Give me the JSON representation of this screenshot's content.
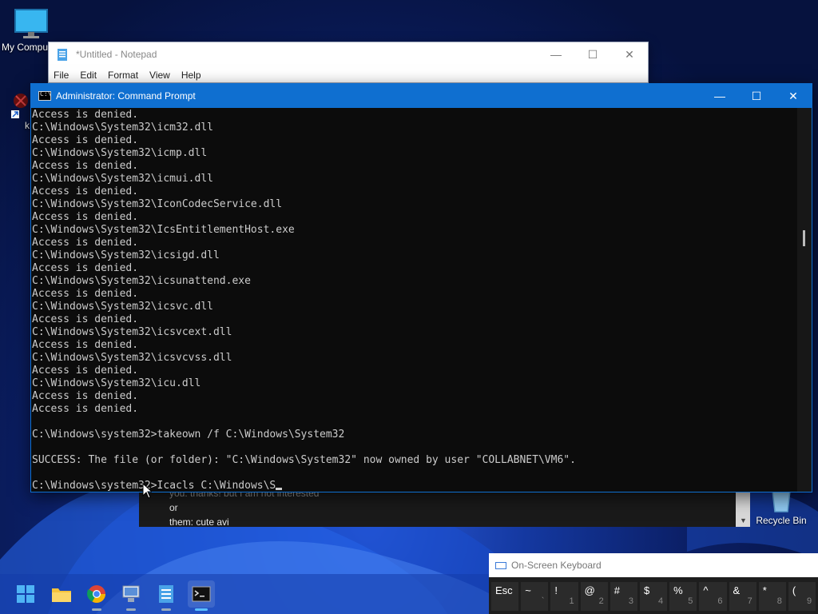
{
  "desktop": {
    "icons": [
      {
        "label": "My Compu"
      },
      {
        "label": "k"
      },
      {
        "label": "Recycle Bin"
      }
    ]
  },
  "notepad": {
    "title": "*Untitled - Notepad",
    "menu": [
      "File",
      "Edit",
      "Format",
      "View",
      "Help"
    ]
  },
  "cmd": {
    "title": "Administrator: Command Prompt",
    "lines": [
      "Access is denied.",
      "C:\\Windows\\System32\\icm32.dll",
      "Access is denied.",
      "C:\\Windows\\System32\\icmp.dll",
      "Access is denied.",
      "C:\\Windows\\System32\\icmui.dll",
      "Access is denied.",
      "C:\\Windows\\System32\\IconCodecService.dll",
      "Access is denied.",
      "C:\\Windows\\System32\\IcsEntitlementHost.exe",
      "Access is denied.",
      "C:\\Windows\\System32\\icsigd.dll",
      "Access is denied.",
      "C:\\Windows\\System32\\icsunattend.exe",
      "Access is denied.",
      "C:\\Windows\\System32\\icsvc.dll",
      "Access is denied.",
      "C:\\Windows\\System32\\icsvcext.dll",
      "Access is denied.",
      "C:\\Windows\\System32\\icsvcvss.dll",
      "Access is denied.",
      "C:\\Windows\\System32\\icu.dll",
      "Access is denied.",
      "Access is denied.",
      "",
      "C:\\Windows\\system32>takeown /f C:\\Windows\\System32",
      "",
      "SUCCESS: The file (or folder): \"C:\\Windows\\System32\" now owned by user \"COLLABNET\\VM6\".",
      ""
    ],
    "prompt": "C:\\Windows\\system32>",
    "input": "Icacls C:\\Windows\\S"
  },
  "chat": {
    "lines": [
      "you: thanks! but I am not interested",
      "or",
      "them: cute avi"
    ]
  },
  "osk": {
    "title": "On-Screen Keyboard",
    "keys": [
      {
        "main": "Esc",
        "sub": ""
      },
      {
        "main": "~",
        "sub": "`"
      },
      {
        "main": "!",
        "sub": "1"
      },
      {
        "main": "@",
        "sub": "2"
      },
      {
        "main": "#",
        "sub": "3"
      },
      {
        "main": "$",
        "sub": "4"
      },
      {
        "main": "%",
        "sub": "5"
      },
      {
        "main": "^",
        "sub": "6"
      },
      {
        "main": "&",
        "sub": "7"
      },
      {
        "main": "*",
        "sub": "8"
      },
      {
        "main": "(",
        "sub": "9"
      }
    ]
  },
  "taskbar": {
    "items": [
      "start-icon",
      "file-explorer-icon",
      "chrome-icon",
      "network-app-icon",
      "notepad-icon",
      "command-prompt-icon"
    ]
  },
  "colors": {
    "cmd_accent": "#0f6fd0",
    "cmd_text": "#cccccc",
    "cmd_bg": "#0c0c0c"
  }
}
